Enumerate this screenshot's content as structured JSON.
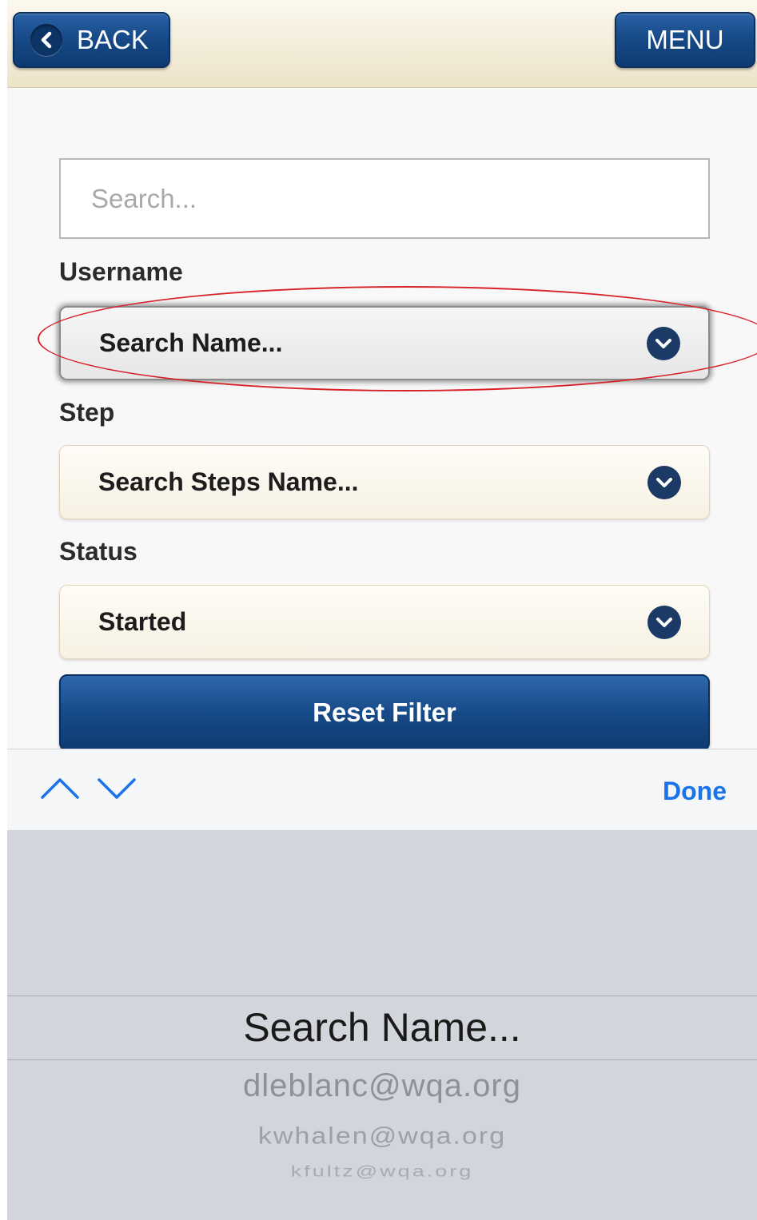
{
  "header": {
    "back_label": "BACK",
    "menu_label": "MENU"
  },
  "filters": {
    "search_placeholder": "Search...",
    "username_label": "Username",
    "username_value": "Search Name...",
    "step_label": "Step",
    "step_value": "Search Steps Name...",
    "status_label": "Status",
    "status_value": "Started",
    "reset_label": "Reset Filter"
  },
  "toolbar": {
    "done_label": "Done"
  },
  "picker": {
    "selected": "Search Name...",
    "options": [
      "dleblanc@wqa.org",
      "kwhalen@wqa.org",
      "kfultz@wqa.org"
    ]
  },
  "colors": {
    "brand_blue": "#174a88",
    "done_blue": "#1a73e8",
    "annotation_red": "#d8222a"
  },
  "icons": {
    "back": "chevron-left-icon",
    "select": "chevron-down-circle-icon",
    "prev": "chevron-up-icon",
    "next": "chevron-down-icon"
  }
}
